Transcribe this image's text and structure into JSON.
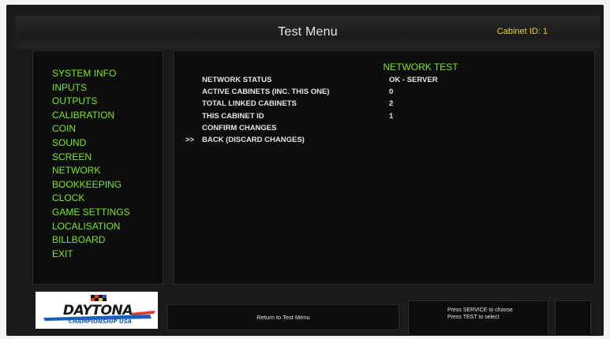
{
  "header": {
    "title": "Test Menu",
    "cabinet_id": "Cabinet ID: 1"
  },
  "sidebar": {
    "items": [
      {
        "label": "SYSTEM INFO"
      },
      {
        "label": "INPUTS"
      },
      {
        "label": "OUTPUTS"
      },
      {
        "label": "CALIBRATION"
      },
      {
        "label": "COIN"
      },
      {
        "label": "SOUND"
      },
      {
        "label": "SCREEN"
      },
      {
        "label": "NETWORK"
      },
      {
        "label": "BOOKKEEPING"
      },
      {
        "label": "CLOCK"
      },
      {
        "label": "GAME SETTINGS"
      },
      {
        "label": "LOCALISATION"
      },
      {
        "label": "BILLBOARD"
      },
      {
        "label": "EXIT"
      }
    ]
  },
  "main": {
    "section_title": "NETWORK TEST",
    "cursor": ">>",
    "rows": [
      {
        "label": "NETWORK STATUS",
        "value": "OK - SERVER"
      },
      {
        "label": "ACTIVE CABINETS (INC. THIS ONE)",
        "value": "0"
      },
      {
        "label": "TOTAL LINKED CABINETS",
        "value": "2"
      },
      {
        "label": "THIS CABINET ID",
        "value": "1"
      },
      {
        "label": "CONFIRM CHANGES",
        "value": ""
      },
      {
        "label": "BACK (DISCARD CHANGES)",
        "value": ""
      }
    ]
  },
  "footer": {
    "logo_title": "DAYTONA",
    "logo_subtitle": "CHAMPIONSHIP USA",
    "return_text": "Return to Test Menu",
    "help_line1": "Press SERVICE to choose",
    "help_line2": "Press TEST to select"
  },
  "colors": {
    "accent_green": "#7ce81e",
    "cabinet_yellow": "#e8cf2a",
    "text": "#e6e6e6",
    "panel": "#0c0c0c",
    "logo_blue": "#1c5fb8"
  }
}
